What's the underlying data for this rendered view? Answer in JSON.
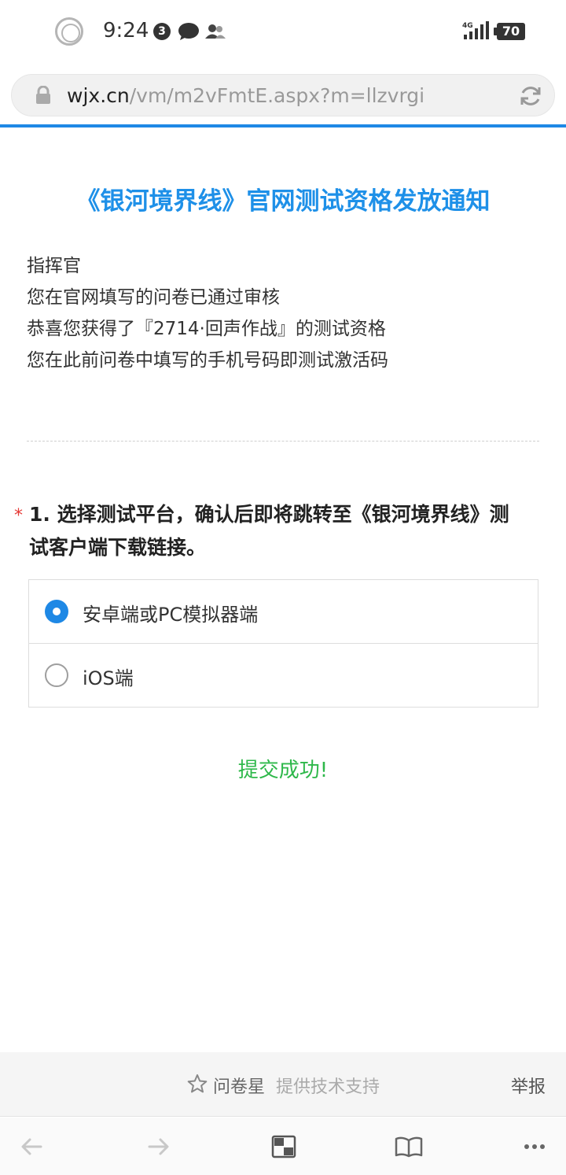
{
  "status_bar": {
    "time": "9:24",
    "notification_count": "3",
    "network": "4G",
    "battery": "70"
  },
  "url_bar": {
    "domain": "wjx.cn",
    "path": "/vm/m2vFmtE.aspx?m=llzvrgi"
  },
  "page": {
    "title": "《银河境界线》官网测试资格发放通知",
    "intro_lines": [
      "指挥官",
      "您在官网填写的问卷已通过审核",
      "恭喜您获得了『2714·回声作战』的测试资格",
      "您在此前问卷中填写的手机号码即测试激活码"
    ],
    "question": {
      "required_mark": "*",
      "title": "1. 选择测试平台，确认后即将跳转至《银河境界线》测试客户端下载链接。",
      "options": [
        {
          "label": "安卓端或PC模拟器端",
          "selected": true
        },
        {
          "label": "iOS端",
          "selected": false
        }
      ]
    },
    "success_message": "提交成功!"
  },
  "footer": {
    "brand": "问卷星",
    "support_text": "提供技术支持",
    "report_label": "举报"
  },
  "colors": {
    "accent": "#1e88e5",
    "title": "#1e90e8",
    "success": "#2eb84a",
    "required": "#e53935"
  }
}
